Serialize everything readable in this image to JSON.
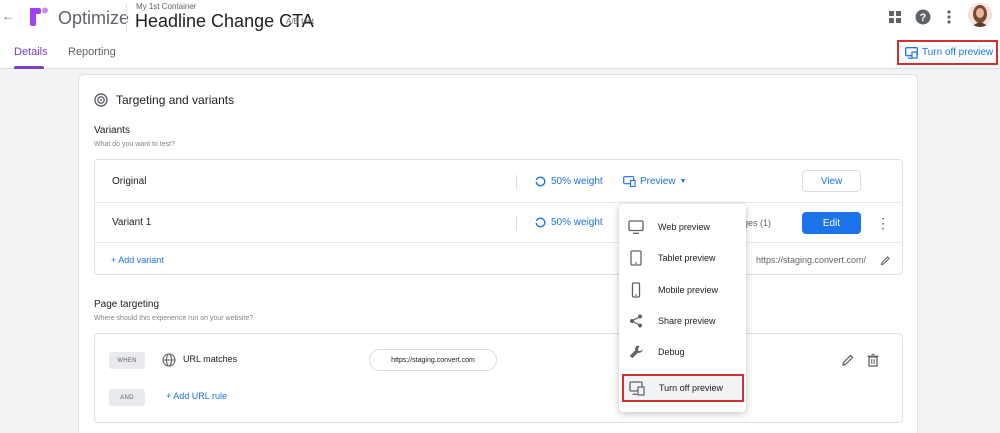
{
  "header": {
    "back_glyph": "←",
    "brand": "Optimize",
    "container_name": "My 1st Container",
    "experiment_title": "Headline Change CTA",
    "experiment_type": "A/B test",
    "icons": [
      "apps-icon",
      "help-icon",
      "more-vert-icon",
      "avatar"
    ]
  },
  "tabs": {
    "details": "Details",
    "reporting": "Reporting",
    "active": "details",
    "turn_off_preview": "Turn off preview"
  },
  "targeting_card": {
    "title": "Targeting and variants",
    "variants_title": "Variants",
    "variants_subtitle": "What do you want to test?",
    "variants": [
      {
        "name": "Original",
        "weight": "50% weight",
        "preview_label": "Preview",
        "action": "View"
      },
      {
        "name": "Variant 1",
        "weight": "50% weight",
        "pages": "ges (1)",
        "action": "Edit"
      }
    ],
    "add_variant": "+ Add variant",
    "editor_url": "https://staging.convert.com/",
    "page_targeting_title": "Page targeting",
    "page_targeting_subtitle": "Where should this experience run on your website?",
    "rule_when": "WHEN",
    "rule_condition": "URL matches",
    "rule_value": "https://staging.convert.com",
    "rule_and": "AND",
    "add_url_rule": "+ Add URL rule"
  },
  "preview_menu": {
    "items": [
      {
        "label": "Web preview",
        "icon": "monitor-icon"
      },
      {
        "label": "Tablet preview",
        "icon": "tablet-icon"
      },
      {
        "label": "Mobile preview",
        "icon": "phone-icon"
      },
      {
        "label": "Share preview",
        "icon": "share-icon"
      },
      {
        "label": "Debug",
        "icon": "wrench-icon"
      },
      {
        "label": "Turn off preview",
        "icon": "preview-off-icon",
        "highlighted": true
      }
    ]
  },
  "colors": {
    "accent_blue": "#1a73e8",
    "active_tab": "#7b3fc4",
    "highlight_border": "#d32f2f",
    "background": "#f1f3f4"
  }
}
